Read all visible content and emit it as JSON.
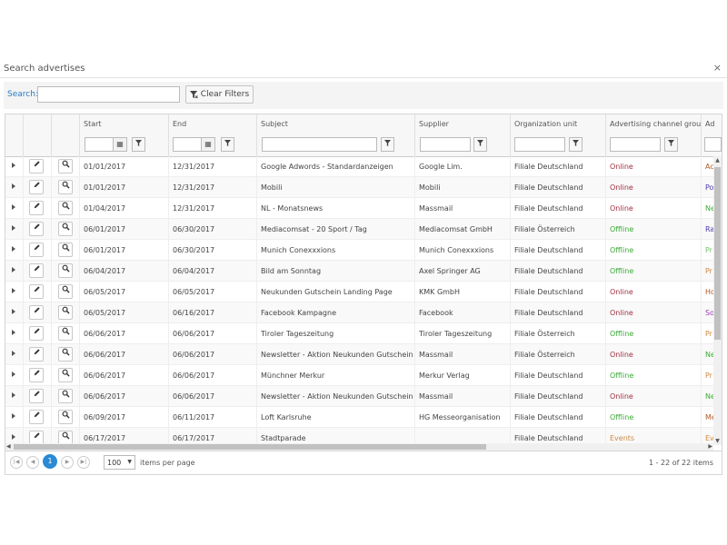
{
  "window": {
    "title": "Search advertises",
    "close_glyph": "×"
  },
  "search": {
    "label": "Search:",
    "value": "",
    "placeholder": "",
    "clear_label": "Clear Filters"
  },
  "columns": [
    "Start",
    "End",
    "Subject",
    "Supplier",
    "Organization unit",
    "Advertising channel group",
    "Ad"
  ],
  "channel_colors": {
    "Online": "#a03040",
    "Offline": "#3aaa35",
    "Events": "#d08a40"
  },
  "rows": [
    {
      "start": "01/01/2017",
      "end": "12/31/2017",
      "subject": "Google Adwords - Standardanzeigen",
      "supplier": "Google Lim.",
      "org": "Filiale Deutschland",
      "channel": "Online",
      "ad": "Ac",
      "ad_color": "#b05a20"
    },
    {
      "start": "01/01/2017",
      "end": "12/31/2017",
      "subject": "Mobili",
      "supplier": "Mobili",
      "org": "Filiale Deutschland",
      "channel": "Online",
      "ad": "Po",
      "ad_color": "#4a3ab0"
    },
    {
      "start": "01/04/2017",
      "end": "12/31/2017",
      "subject": "NL - Monatsnews",
      "supplier": "Massmail",
      "org": "Filiale Deutschland",
      "channel": "Online",
      "ad": "Ne",
      "ad_color": "#3aaa35"
    },
    {
      "start": "06/01/2017",
      "end": "06/30/2017",
      "subject": "Mediacomsat - 20 Sport / Tag",
      "supplier": "Mediacomsat GmbH",
      "org": "Filiale Österreich",
      "channel": "Offline",
      "ad": "Ra",
      "ad_color": "#4a3ab0"
    },
    {
      "start": "06/01/2017",
      "end": "06/30/2017",
      "subject": "Munich Conexxxions",
      "supplier": "Munich Conexxxions",
      "org": "Filiale Deutschland",
      "channel": "Offline",
      "ad": "Pr",
      "ad_color": "#7ac070"
    },
    {
      "start": "06/04/2017",
      "end": "06/04/2017",
      "subject": "Bild am Sonntag",
      "supplier": "Axel Springer AG",
      "org": "Filiale Deutschland",
      "channel": "Offline",
      "ad": "Pr",
      "ad_color": "#d08a40"
    },
    {
      "start": "06/05/2017",
      "end": "06/05/2017",
      "subject": "Neukunden Gutschein Landing Page",
      "supplier": "KMK GmbH",
      "org": "Filiale Deutschland",
      "channel": "Online",
      "ad": "Ho",
      "ad_color": "#b05a20"
    },
    {
      "start": "06/05/2017",
      "end": "06/16/2017",
      "subject": "Facebook Kampagne",
      "supplier": "Facebook",
      "org": "Filiale Deutschland",
      "channel": "Online",
      "ad": "So",
      "ad_color": "#9a3ab0"
    },
    {
      "start": "06/06/2017",
      "end": "06/06/2017",
      "subject": "Tiroler Tageszeitung",
      "supplier": "Tiroler Tageszeitung",
      "org": "Filiale Österreich",
      "channel": "Offline",
      "ad": "Pr",
      "ad_color": "#d08a40"
    },
    {
      "start": "06/06/2017",
      "end": "06/06/2017",
      "subject": "Newsletter - Aktion Neukunden Gutschein",
      "supplier": "Massmail",
      "org": "Filiale Österreich",
      "channel": "Online",
      "ad": "Ne",
      "ad_color": "#3aaa35"
    },
    {
      "start": "06/06/2017",
      "end": "06/06/2017",
      "subject": "Münchner Merkur",
      "supplier": "Merkur Verlag",
      "org": "Filiale Deutschland",
      "channel": "Offline",
      "ad": "Pr",
      "ad_color": "#d08a40"
    },
    {
      "start": "06/06/2017",
      "end": "06/06/2017",
      "subject": "Newsletter - Aktion Neukunden Gutschein",
      "supplier": "Massmail",
      "org": "Filiale Deutschland",
      "channel": "Online",
      "ad": "Ne",
      "ad_color": "#3aaa35"
    },
    {
      "start": "06/09/2017",
      "end": "06/11/2017",
      "subject": "Loft Karlsruhe",
      "supplier": "HG Messeorganisation",
      "org": "Filiale Deutschland",
      "channel": "Offline",
      "ad": "Me",
      "ad_color": "#b05a20"
    },
    {
      "start": "06/17/2017",
      "end": "06/17/2017",
      "subject": "Stadtparade",
      "supplier": "",
      "org": "Filiale Deutschland",
      "channel": "Events",
      "ad": "Ev",
      "ad_color": "#d08a40"
    }
  ],
  "pager": {
    "first_glyph": "|◀",
    "prev_glyph": "◀",
    "current": "1",
    "next_glyph": "▶",
    "last_glyph": "▶|",
    "page_size": "100",
    "items_label": "items per page",
    "info": "1 - 22 of 22 items"
  },
  "icons": {
    "clear": "funnel-clear-icon",
    "filter": "funnel-icon",
    "calendar": "calendar-icon",
    "edit": "pencil-icon",
    "view": "magnifier-icon",
    "expand": "expand-arrow-icon"
  }
}
